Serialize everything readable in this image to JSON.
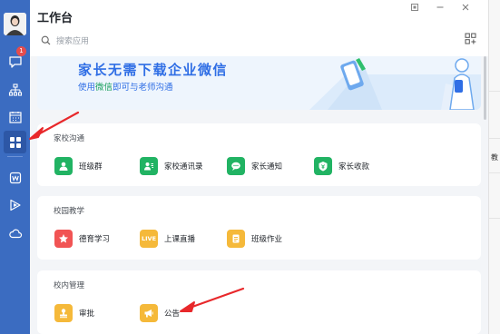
{
  "header": {
    "title": "工作台",
    "search_placeholder": "搜索应用"
  },
  "rail": {
    "message_badge": "1"
  },
  "banner": {
    "headline": "家长无需下载企业微信",
    "sub_prefix": "使用",
    "sub_highlight": "微信",
    "sub_suffix": "即可与老师沟通"
  },
  "sections": {
    "home_school": {
      "title": "家校沟通",
      "apps": [
        "班级群",
        "家校通讯录",
        "家长通知",
        "家长收款"
      ]
    },
    "campus_teaching": {
      "title": "校园教学",
      "apps": [
        "德育学习",
        "上课直播",
        "班级作业"
      ],
      "live_badge": "LIVE"
    },
    "school_admin": {
      "title": "校内管理",
      "apps": [
        "审批",
        "公告"
      ]
    }
  },
  "background_window": {
    "text": "教"
  },
  "colors": {
    "rail": "#3b6cc1",
    "accent_blue": "#2f6ee5",
    "green": "#21b363",
    "red": "#f15454",
    "orange": "#f5b93a",
    "arrow": "#e8282b"
  }
}
